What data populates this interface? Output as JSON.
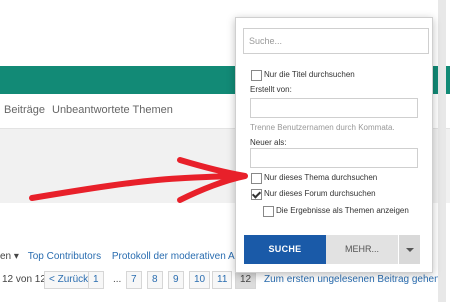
{
  "nav": {
    "items": [
      {
        "label": "Beiträge"
      },
      {
        "label": "Unbeantwortete Themen"
      }
    ]
  },
  "crumbs": {
    "lead": "en",
    "links": [
      "Top Contributors",
      "Protokoll der moderativen Aktionen"
    ]
  },
  "pagination": {
    "count_text": "12 von 12",
    "back": "< Zurück",
    "pages": [
      "1",
      "...",
      "7",
      "8",
      "9",
      "10",
      "11",
      "12"
    ],
    "current": "12",
    "first_unread": "Zum ersten ungelesenen Beitrag gehen"
  },
  "search_panel": {
    "placeholder": "Suche...",
    "titles_only": "Nur die Titel durchsuchen",
    "created_by": "Erstellt von:",
    "separate_hint": "Trenne Benutzernamen durch Kommata.",
    "newer_than": "Neuer als:",
    "this_thread": "Nur dieses Thema durchsuchen",
    "this_forum": "Nur dieses Forum durchsuchen",
    "as_threads": "Die Ergebnisse als Themen anzeigen",
    "search_button": "SUCHE",
    "more_button": "MEHR...",
    "this_forum_checked": true
  },
  "colors": {
    "accent": "#128a76",
    "primary_button": "#1a5aa8",
    "annotation_arrow": "#e8202a"
  }
}
